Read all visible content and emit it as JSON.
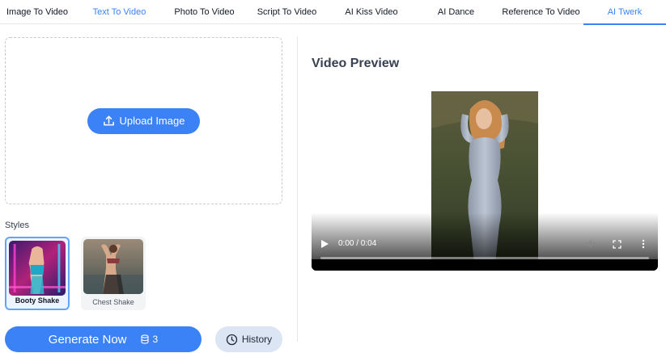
{
  "tabs": [
    {
      "label": "Image To Video"
    },
    {
      "label": "Text To Video"
    },
    {
      "label": "Photo To Video"
    },
    {
      "label": "Script To Video"
    },
    {
      "label": "AI Kiss Video"
    },
    {
      "label": "AI Dance"
    },
    {
      "label": "Reference To Video"
    },
    {
      "label": "AI Twerk"
    }
  ],
  "upload": {
    "label": "Upload Image"
  },
  "styles": {
    "heading": "Styles",
    "items": [
      {
        "name": "Booty Shake",
        "selected": true
      },
      {
        "name": "Chest Shake",
        "selected": false
      }
    ]
  },
  "actions": {
    "generate_label": "Generate Now",
    "credits": "3",
    "history_label": "History"
  },
  "preview": {
    "title": "Video Preview",
    "time": "0:00 / 0:04"
  },
  "colors": {
    "accent": "#3b82f6",
    "history_bg": "#dbe5f4"
  }
}
